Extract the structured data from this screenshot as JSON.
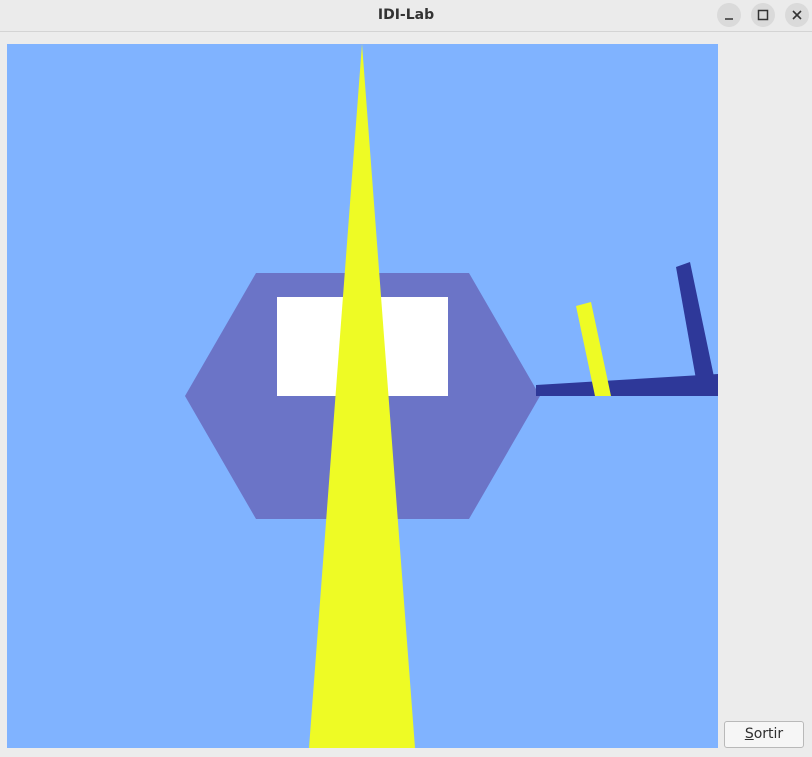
{
  "window": {
    "title": "IDI-Lab",
    "controls": [
      "minimize-icon",
      "maximize-icon",
      "close-icon"
    ]
  },
  "scene": {
    "background_color": "#80b3ff",
    "hexagon_color": "#6b74c7",
    "window_color": "#ffffff",
    "beam_color": "#eefb25",
    "arm_color": "#2e3899"
  },
  "buttons": {
    "quit_mnemonic": "S",
    "quit_rest": "ortir"
  }
}
